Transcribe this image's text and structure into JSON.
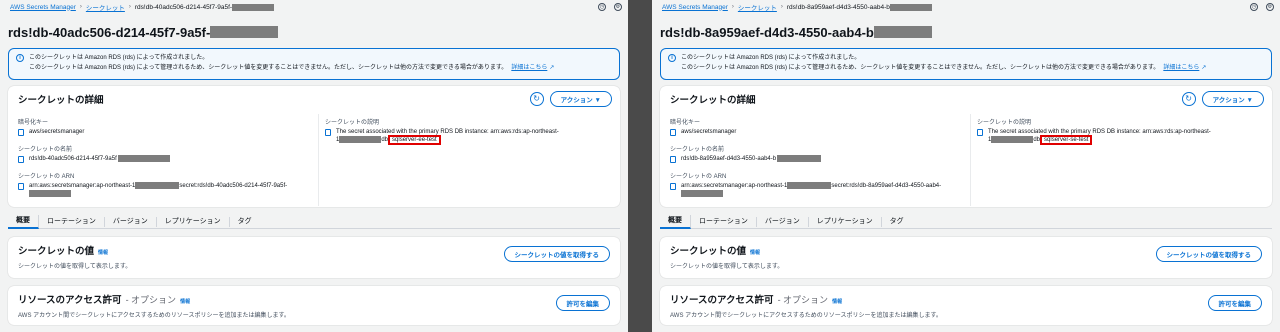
{
  "common": {
    "breadcrumb_service": "AWS Secrets Manager",
    "breadcrumb_secrets": "シークレット",
    "alert_line1": "このシークレットは Amazon RDS (rds) によって作成されました。",
    "alert_line2": "このシークレットは Amazon RDS (rds) によって管理されるため、シークレット値を変更することはできません。ただし、シークレットは他の方法で変更できる場合があります。",
    "alert_link": "詳細はこちら",
    "details_title": "シークレットの詳細",
    "actions_label": "アクション ▼",
    "encryption_key_label": "暗号化キー",
    "encryption_key_value": "aws/secretsmanager",
    "secret_name_label": "シークレットの名前",
    "secret_arn_label": "シークレットの ARN",
    "arn_prefix": "arn:aws:secretsmanager:ap-northeast-1",
    "description_label": "シークレットの説明",
    "description_text": "The secret associated with the primary RDS DB instance: arn:aws:rds:ap-northeast-",
    "description_prefix": "1",
    "description_db_prefix": "db",
    "tabs": [
      "概要",
      "ローテーション",
      "バージョン",
      "レプリケーション",
      "タグ"
    ],
    "value_title": "シークレットの値",
    "info_label": "情報",
    "value_desc": "シークレットの値を取得して表示します。",
    "get_value_button": "シークレットの値を取得する",
    "perm_title": "リソースのアクセス許可",
    "perm_optional": "- オプション",
    "perm_desc": "AWS アカウント間でシークレットにアクセスするためのリソースポリシーを追加または編集します。",
    "edit_perm_button": "許可を編集"
  },
  "left": {
    "breadcrumb_current": "rds!db-40adc506-d214-45f7-9a5f-",
    "title": "rds!db-40adc506-d214-45f7-9a5f-",
    "secret_name": "rds!db-40adc506-d214-45f7-9a5f",
    "arn_suffix": "secret:rds!db-40adc506-d214-45f7-9a5f-",
    "db_name": "sqlserver-ee-test"
  },
  "right": {
    "breadcrumb_current": "rds!db-8a959aef-d4d3-4550-aab4-b",
    "title": "rds!db-8a959aef-d4d3-4550-aab4-b",
    "secret_name": "rds!db-8a959aef-d4d3-4550-aab4-b",
    "arn_suffix": "secret:rds!db-8a959aef-d4d3-4550-aab4-",
    "db_name": "sqlserver-se-test"
  }
}
